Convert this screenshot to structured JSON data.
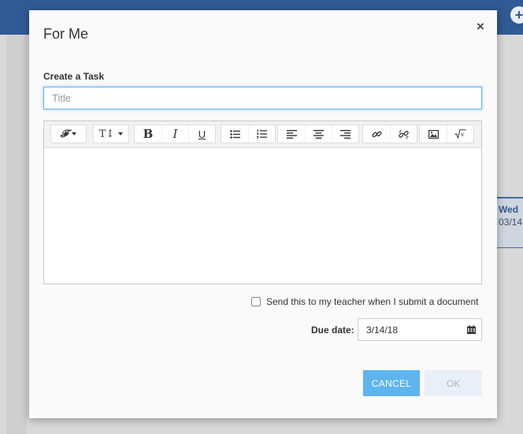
{
  "background": {
    "calendar_day": "Wed",
    "calendar_date": "03/14"
  },
  "modal": {
    "title": "For Me",
    "close_glyph": "×",
    "section_label": "Create a Task",
    "title_placeholder": "Title",
    "toolbar": {
      "font_glyph": "𝓕",
      "size_glyph": "T↕",
      "bold_glyph": "B",
      "italic_glyph": "I",
      "underline_glyph": "U"
    },
    "send_to_teacher_label": "Send this to my teacher when I submit a document",
    "due_date_label": "Due date:",
    "due_date_value": "3/14/18",
    "cancel_label": "CANCEL",
    "ok_label": "OK"
  },
  "colors": {
    "topbar": "#2f5a93",
    "cancel_button": "#5eb4ef",
    "ok_button": "#e8eff7",
    "input_focus": "#66afe9"
  }
}
